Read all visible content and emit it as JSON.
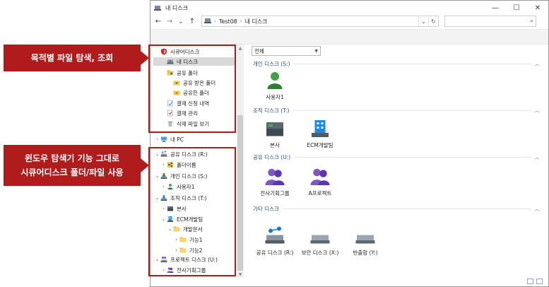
{
  "callouts": {
    "purpose": "목적별 파일 탐색, 조회",
    "explorer_line1": "윈도우 탐색기 기능 그대로",
    "explorer_line2": "시큐어디스크 폴더/파일 사용"
  },
  "window": {
    "title": "내 디스크",
    "controls": {
      "minimize": "—",
      "maximize": "☐",
      "close": "✕"
    }
  },
  "address": {
    "back": "←",
    "forward": "→",
    "recent": "⌄",
    "up": "↑",
    "path": [
      "Test08",
      "내 디스크"
    ],
    "dropdown": "⌄",
    "refresh": "↻",
    "search_icon": "⌕"
  },
  "nav": {
    "items": [
      {
        "label": "시큐어디스크",
        "icon": "shield-icon",
        "exp": "",
        "indent": 0,
        "selected": false
      },
      {
        "label": "내 디스크",
        "icon": "drive-icon",
        "exp": "",
        "indent": 1,
        "selected": true
      },
      {
        "label": "공유 폴더",
        "icon": "share-folder-icon",
        "exp": "",
        "indent": 1,
        "selected": false
      },
      {
        "label": "공유 받은 폴더",
        "icon": "received-folder-icon",
        "exp": "",
        "indent": 2,
        "selected": false
      },
      {
        "label": "공유한 폴더",
        "icon": "shared-folder-icon",
        "exp": "",
        "indent": 2,
        "selected": false
      },
      {
        "label": "결재 신청 내역",
        "icon": "approval-request-icon",
        "exp": "",
        "indent": 1,
        "selected": false
      },
      {
        "label": "결재 관리",
        "icon": "approval-manage-icon",
        "exp": "",
        "indent": 1,
        "selected": false
      },
      {
        "label": "삭제 파일 보기",
        "icon": "trash-icon",
        "exp": "",
        "indent": 1,
        "selected": false
      },
      {
        "label": "내 PC",
        "icon": "pc-icon",
        "exp": ">",
        "indent": 0,
        "selected": false
      },
      {
        "label": "공유 디스크 (R:)",
        "icon": "share-disk-icon",
        "exp": "v",
        "indent": 0,
        "selected": false
      },
      {
        "label": "폴더이름",
        "icon": "share-node-icon",
        "exp": ">",
        "indent": 1,
        "selected": false
      },
      {
        "label": "개인 디스크 (S:)",
        "icon": "personal-disk-icon",
        "exp": "v",
        "indent": 0,
        "selected": false
      },
      {
        "label": "사용자1",
        "icon": "user-icon",
        "exp": ">",
        "indent": 1,
        "selected": false
      },
      {
        "label": "조직 디스크 (T:)",
        "icon": "org-disk-icon",
        "exp": "v",
        "indent": 0,
        "selected": false
      },
      {
        "label": "본사",
        "icon": "server-icon",
        "exp": ">",
        "indent": 1,
        "selected": false
      },
      {
        "label": "ECM개발팀",
        "icon": "building-icon",
        "exp": "v",
        "indent": 1,
        "selected": false
      },
      {
        "label": "개발문서",
        "icon": "folder-icon",
        "exp": "v",
        "indent": 2,
        "selected": false
      },
      {
        "label": "기능1",
        "icon": "folder-icon",
        "exp": ">",
        "indent": 3,
        "selected": false
      },
      {
        "label": "기능2",
        "icon": "folder-icon",
        "exp": ">",
        "indent": 3,
        "selected": false
      },
      {
        "label": "프로젝트 디스크 (U:)",
        "icon": "project-disk-icon",
        "exp": "v",
        "indent": 0,
        "selected": false
      },
      {
        "label": "전사기획그룹",
        "icon": "group-icon",
        "exp": ">",
        "indent": 1,
        "selected": false
      }
    ]
  },
  "content": {
    "filter": "전체",
    "groups": [
      {
        "header": "개인 디스크 (S:)",
        "tiles": [
          {
            "label": "사용자1",
            "icon": "user-icon"
          }
        ]
      },
      {
        "header": "조직 디스크 (T:)",
        "tiles": [
          {
            "label": "본사",
            "icon": "server-icon"
          },
          {
            "label": "ECM개발팀",
            "icon": "building-icon"
          }
        ]
      },
      {
        "header": "공유 디스크 (U:)",
        "tiles": [
          {
            "label": "전사기획그룹",
            "icon": "group-icon"
          },
          {
            "label": "A프로젝트",
            "icon": "group-icon"
          }
        ]
      },
      {
        "header": "기타 디스크",
        "tiles": [
          {
            "label": "공유 디스크 (R:)",
            "icon": "share-disk-icon"
          },
          {
            "label": "보안 디스크 (X:)",
            "icon": "secure-disk-icon"
          },
          {
            "label": "반출함 (Y:)",
            "icon": "outbox-disk-icon"
          }
        ]
      }
    ]
  },
  "colors": {
    "accent": "#b01c1c",
    "group_header": "#1e4e9c"
  }
}
